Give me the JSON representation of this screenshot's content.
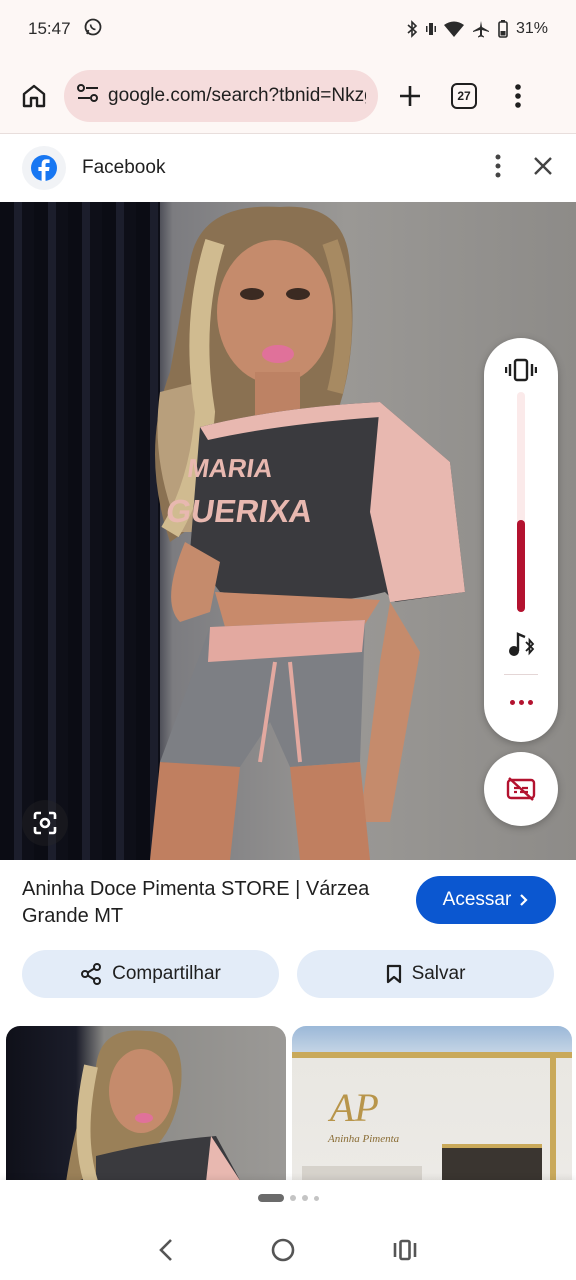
{
  "status": {
    "time": "15:47",
    "battery": "31%"
  },
  "browser": {
    "url": "google.com/search?tbnid=Nkzgu",
    "tab_count": "27"
  },
  "source": {
    "name": "Facebook"
  },
  "image": {
    "shirt_text_line1": "MARIA",
    "shirt_text_line2": "GUERIXA"
  },
  "volume": {
    "level": 0.42
  },
  "result": {
    "title": "Aninha Doce Pimenta STORE | Várzea Grande MT",
    "visit_label": "Acessar"
  },
  "actions": {
    "share_label": "Compartilhar",
    "save_label": "Salvar"
  },
  "thumbnails": {
    "store_logo": "AP",
    "store_name": "Aninha Pimenta"
  },
  "colors": {
    "accent": "#0b57d0",
    "volume": "#b3122f",
    "url_bar": "#f5dcdc"
  }
}
